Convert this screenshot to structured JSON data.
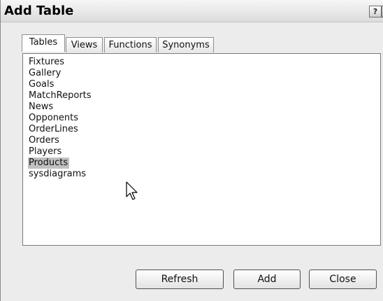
{
  "window": {
    "title": "Add Table",
    "help_glyph": "?",
    "close_glyph": "✕"
  },
  "tabs": [
    {
      "label": "Tables",
      "active": true
    },
    {
      "label": "Views",
      "active": false
    },
    {
      "label": "Functions",
      "active": false
    },
    {
      "label": "Synonyms",
      "active": false
    }
  ],
  "list": {
    "items": [
      "Fixtures",
      "Gallery",
      "Goals",
      "MatchReports",
      "News",
      "Opponents",
      "OrderLines",
      "Orders",
      "Players",
      "Products",
      "sysdiagrams"
    ],
    "selected": "Products"
  },
  "buttons": {
    "refresh": "Refresh",
    "add": "Add",
    "close": "Close"
  },
  "icons": {
    "cursor": "mouse-pointer-icon",
    "help": "help-icon",
    "close": "close-icon"
  },
  "colors": {
    "selection": "#c0c0c0",
    "dialog_bg": "#ececec"
  }
}
